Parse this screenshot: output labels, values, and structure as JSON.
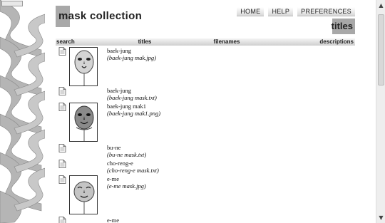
{
  "header": {
    "title": "mask collection",
    "view_title": "titles",
    "nav": [
      "HOME",
      "HELP",
      "PREFERENCES"
    ]
  },
  "tabs": [
    "search",
    "titles",
    "filenames",
    "descriptions"
  ],
  "results": [
    {
      "title": "baek-jung",
      "filename": "(baek-jung mak.jpg)",
      "has_thumb": true,
      "thumb_type": "mask-white",
      "icon": "document-icon"
    },
    {
      "title": "baek-jung",
      "filename": "(baek-jung mask.txt)",
      "has_thumb": false,
      "icon": "document-icon"
    },
    {
      "title": "baek-jung mak1",
      "filename": "(baek-jung mak1.png)",
      "has_thumb": true,
      "thumb_type": "mask-dark",
      "icon": "document-icon"
    },
    {
      "title": "bu-ne",
      "filename": "(bu-ne mask.txt)",
      "has_thumb": false,
      "icon": "document-icon"
    },
    {
      "title": "cho-reng-e",
      "filename": "(cho-reng-e mask.txt)",
      "has_thumb": false,
      "icon": "document-icon"
    },
    {
      "title": "e-me",
      "filename": "(e-me mask.jpg)",
      "has_thumb": true,
      "thumb_type": "mask-round",
      "icon": "document-icon"
    },
    {
      "title": "e-me",
      "filename": "",
      "has_thumb": false,
      "icon": "document-icon"
    }
  ],
  "colors": {
    "title_box": "#a8a8a8",
    "tab_gradient_top": "#f4f4f4",
    "tab_gradient_bottom": "#cfcfcf",
    "braid": "#b5b5b5"
  },
  "icons": {
    "scroll_up": "▲",
    "scroll_down": "▼"
  }
}
